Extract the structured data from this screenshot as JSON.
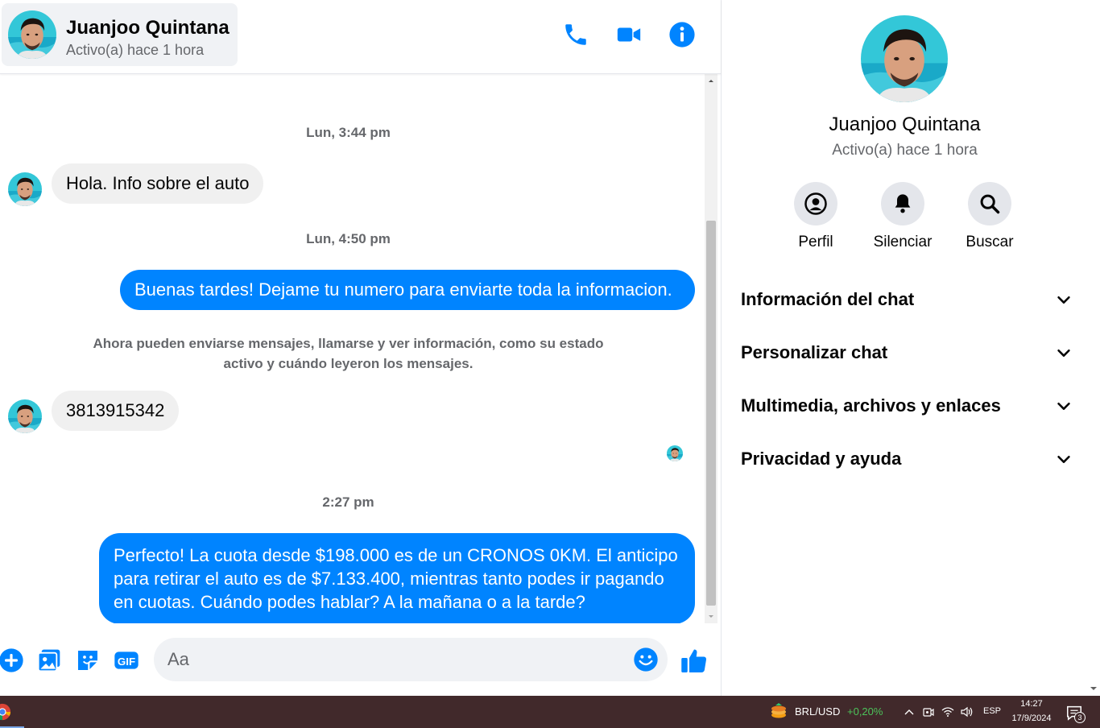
{
  "contact": {
    "name": "Juanjoo Quintana",
    "status": "Activo(a) hace 1 hora"
  },
  "messages": {
    "ts1": "Lun, 3:44 pm",
    "msg1": "Hola. Info sobre el auto",
    "ts2": "Lun, 4:50 pm",
    "msg2": "Buenas tardes! Dejame tu numero para enviarte toda la informacion.",
    "system_note": "Ahora pueden enviarse mensajes, llamarse y ver información, como su estado activo y cuándo leyeron los mensajes.",
    "msg3": "3813915342",
    "ts3": "2:27 pm",
    "msg4": "Perfecto! La cuota desde $198.000 es de un CRONOS 0KM. El anticipo para retirar el auto es de $7.133.400, mientras tanto podes ir pagando en cuotas. Cuándo podes hablar? A la mañana o a la tarde?"
  },
  "composer": {
    "placeholder": "Aa"
  },
  "panel": {
    "actions": {
      "profile": "Perfil",
      "mute": "Silenciar",
      "search": "Buscar"
    },
    "sections": [
      "Información del chat",
      "Personalizar chat",
      "Multimedia, archivos y enlaces",
      "Privacidad y ayuda"
    ]
  },
  "taskbar": {
    "currency_pair": "BRL/USD",
    "currency_change": "+0,20%",
    "language": "ESP",
    "time": "14:27",
    "date": "17/9/2024",
    "notification_count": "3"
  },
  "colors": {
    "accent": "#0084ff",
    "incoming_bubble": "#f0f0f0",
    "taskbar": "#41292b",
    "positive_change": "#4cc35a"
  },
  "icons": {
    "header": [
      "phone-icon",
      "video-camera-icon",
      "info-icon"
    ],
    "composer": [
      "plus-icon",
      "image-icon",
      "sticker-icon",
      "gif-icon",
      "emoji-icon",
      "thumbs-up-icon"
    ],
    "panel": [
      "profile-icon",
      "bell-icon",
      "search-icon",
      "chevron-down-icon"
    ]
  }
}
